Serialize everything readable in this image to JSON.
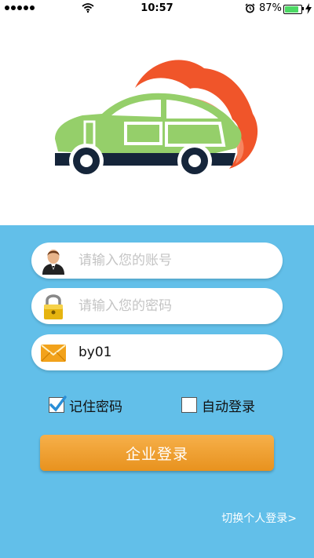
{
  "status_bar": {
    "time": "10:57",
    "battery_percent": "87%",
    "battery_level": 0.87
  },
  "form": {
    "account": {
      "placeholder": "请输入您的账号",
      "value": ""
    },
    "password": {
      "placeholder": "请输入您的密码",
      "value": ""
    },
    "enterprise_code": {
      "value": "by01"
    },
    "remember_password": {
      "label": "记住密码",
      "checked": true
    },
    "auto_login": {
      "label": "自动登录",
      "checked": false
    },
    "login_button": "企业登录",
    "switch_link": "切换个人登录>"
  },
  "colors": {
    "form_background": "#62bfe9",
    "button": "#f0a030",
    "car_body": "#95cf6a",
    "car_outline": "#15253a",
    "cloud": "#f0552a"
  }
}
